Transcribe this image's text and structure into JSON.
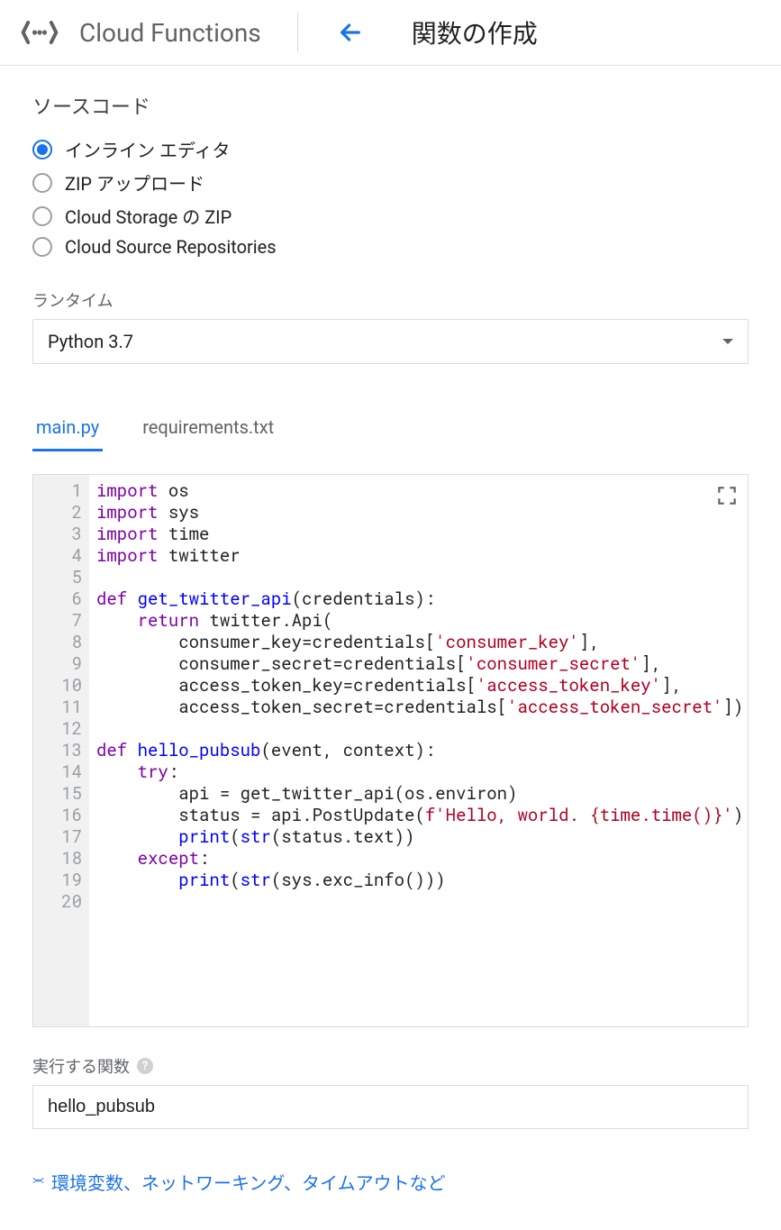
{
  "header": {
    "product": "Cloud Functions",
    "page_title": "関数の作成"
  },
  "source_section": {
    "label": "ソースコード",
    "options": [
      {
        "label": "インライン エディタ",
        "selected": true
      },
      {
        "label": "ZIP アップロード",
        "selected": false
      },
      {
        "label": "Cloud Storage の ZIP",
        "selected": false
      },
      {
        "label": "Cloud Source Repositories",
        "selected": false
      }
    ]
  },
  "runtime": {
    "label": "ランタイム",
    "value": "Python 3.7"
  },
  "tabs": [
    {
      "label": "main.py",
      "active": true
    },
    {
      "label": "requirements.txt",
      "active": false
    }
  ],
  "code": {
    "line_count": 20,
    "lines": [
      [
        [
          "kw",
          "import"
        ],
        [
          "",
          " os"
        ]
      ],
      [
        [
          "kw",
          "import"
        ],
        [
          "",
          " sys"
        ]
      ],
      [
        [
          "kw",
          "import"
        ],
        [
          "",
          " time"
        ]
      ],
      [
        [
          "kw",
          "import"
        ],
        [
          "",
          " twitter"
        ]
      ],
      [
        [
          "",
          ""
        ]
      ],
      [
        [
          "kw",
          "def "
        ],
        [
          "fn",
          "get_twitter_api"
        ],
        [
          "",
          "(credentials):"
        ]
      ],
      [
        [
          "",
          "    "
        ],
        [
          "kw",
          "return"
        ],
        [
          "",
          " twitter.Api("
        ]
      ],
      [
        [
          "",
          "        consumer_key=credentials["
        ],
        [
          "str",
          "'consumer_key'"
        ],
        [
          "",
          "],"
        ]
      ],
      [
        [
          "",
          "        consumer_secret=credentials["
        ],
        [
          "str",
          "'consumer_secret'"
        ],
        [
          "",
          "],"
        ]
      ],
      [
        [
          "",
          "        access_token_key=credentials["
        ],
        [
          "str",
          "'access_token_key'"
        ],
        [
          "",
          "],"
        ]
      ],
      [
        [
          "",
          "        access_token_secret=credentials["
        ],
        [
          "str",
          "'access_token_secret'"
        ],
        [
          "",
          "])"
        ]
      ],
      [
        [
          "",
          ""
        ]
      ],
      [
        [
          "kw",
          "def "
        ],
        [
          "fn",
          "hello_pubsub"
        ],
        [
          "",
          "(event, context):"
        ]
      ],
      [
        [
          "",
          "    "
        ],
        [
          "kw",
          "try"
        ],
        [
          "",
          ":"
        ]
      ],
      [
        [
          "",
          "        api = get_twitter_api(os.environ)"
        ]
      ],
      [
        [
          "",
          "        status = api.PostUpdate("
        ],
        [
          "str",
          "f'Hello, world. {time.time()}'"
        ],
        [
          "",
          ")"
        ]
      ],
      [
        [
          "",
          "        "
        ],
        [
          "bi",
          "print"
        ],
        [
          "",
          "("
        ],
        [
          "bi",
          "str"
        ],
        [
          "",
          "(status.text))"
        ]
      ],
      [
        [
          "",
          "    "
        ],
        [
          "kw",
          "except"
        ],
        [
          "",
          ":"
        ]
      ],
      [
        [
          "",
          "        "
        ],
        [
          "bi",
          "print"
        ],
        [
          "",
          "("
        ],
        [
          "bi",
          "str"
        ],
        [
          "",
          "(sys.exc_info()))"
        ]
      ],
      [
        [
          "",
          ""
        ]
      ]
    ]
  },
  "exec_function": {
    "label": "実行する関数",
    "value": "hello_pubsub"
  },
  "expand_link": "環境変数、ネットワーキング、タイムアウトなど"
}
